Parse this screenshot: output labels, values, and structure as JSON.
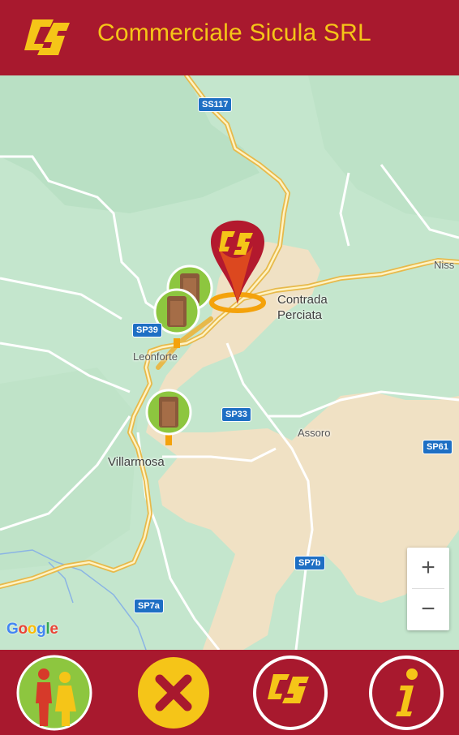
{
  "header": {
    "title": "Commerciale Sicula SRL",
    "logo_icon": "cs-logo-icon",
    "colors": {
      "bar": "#a8192e",
      "title": "#f5c518"
    }
  },
  "map": {
    "road_labels": [
      "SS117",
      "SP39",
      "SP33",
      "SP61",
      "SP7b",
      "SP7a"
    ],
    "places": [
      "Contrada\nPerciata",
      "Leonforte",
      "Assoro",
      "Villarmosa",
      "Niss"
    ],
    "markers": [
      "toilet-marker",
      "toilet-marker",
      "toilet-marker",
      "cs-location-pin"
    ],
    "attribution": "Google",
    "zoom": {
      "in": "+",
      "out": "−"
    }
  },
  "bottom_nav": {
    "buttons": [
      {
        "icon": "restroom-people-icon"
      },
      {
        "icon": "close-x-icon"
      },
      {
        "icon": "cs-logo-icon"
      },
      {
        "icon": "info-icon"
      }
    ]
  }
}
